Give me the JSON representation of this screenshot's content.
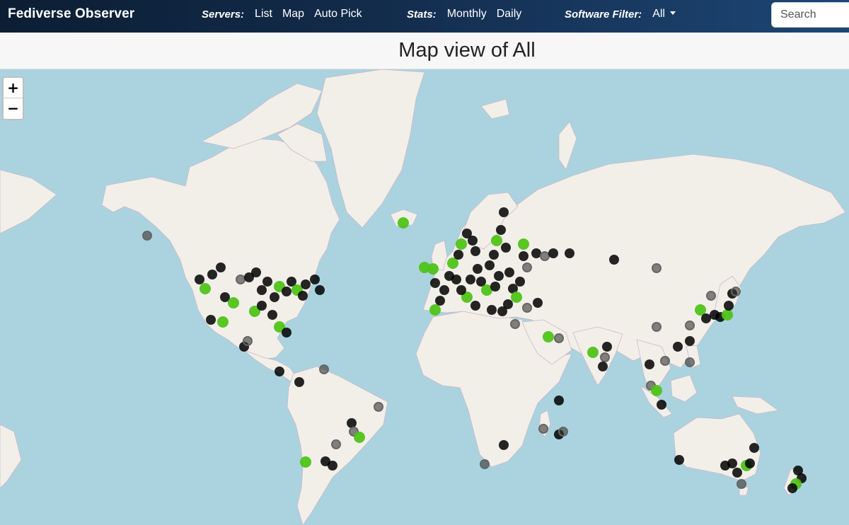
{
  "navbar": {
    "brand": "Fediverse Observer",
    "servers_label": "Servers:",
    "servers_links": [
      "List",
      "Map",
      "Auto Pick"
    ],
    "stats_label": "Stats:",
    "stats_links": [
      "Monthly",
      "Daily"
    ],
    "filter_label": "Software Filter:",
    "filter_value": "All",
    "search_placeholder": "Search"
  },
  "page": {
    "title": "Map view of All"
  },
  "map": {
    "zoom_in": "+",
    "zoom_out": "−",
    "colors": {
      "water": "#aad3df",
      "land": "#f2efe9",
      "border": "#c9b8c8",
      "marker_black": "#000000",
      "marker_green": "#4fc318"
    }
  }
}
